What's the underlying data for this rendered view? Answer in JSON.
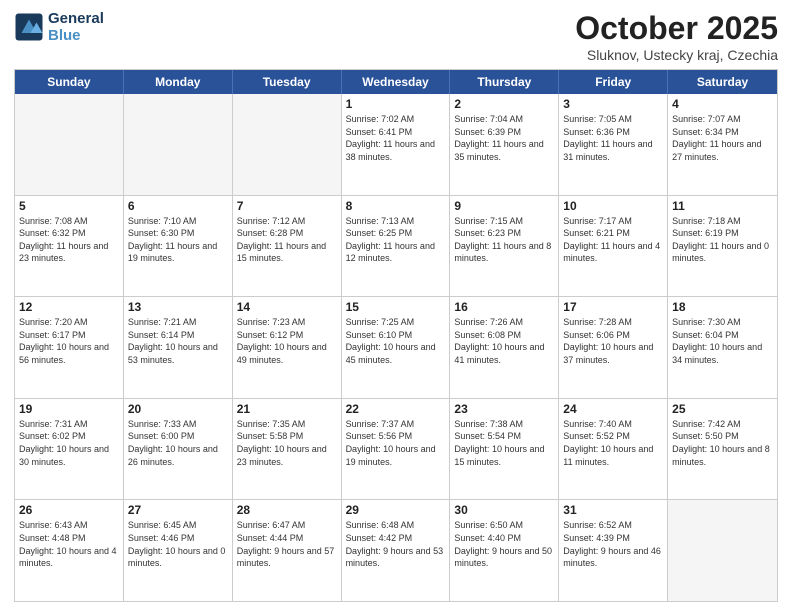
{
  "logo": {
    "line1": "General",
    "line2": "Blue"
  },
  "title": "October 2025",
  "subtitle": "Sluknov, Ustecky kraj, Czechia",
  "header": {
    "days": [
      "Sunday",
      "Monday",
      "Tuesday",
      "Wednesday",
      "Thursday",
      "Friday",
      "Saturday"
    ]
  },
  "rows": [
    [
      {
        "day": "",
        "empty": true
      },
      {
        "day": "",
        "empty": true
      },
      {
        "day": "",
        "empty": true
      },
      {
        "day": "1",
        "rise": "7:02 AM",
        "set": "6:41 PM",
        "daylight": "11 hours and 38 minutes."
      },
      {
        "day": "2",
        "rise": "7:04 AM",
        "set": "6:39 PM",
        "daylight": "11 hours and 35 minutes."
      },
      {
        "day": "3",
        "rise": "7:05 AM",
        "set": "6:36 PM",
        "daylight": "11 hours and 31 minutes."
      },
      {
        "day": "4",
        "rise": "7:07 AM",
        "set": "6:34 PM",
        "daylight": "11 hours and 27 minutes."
      }
    ],
    [
      {
        "day": "5",
        "rise": "7:08 AM",
        "set": "6:32 PM",
        "daylight": "11 hours and 23 minutes."
      },
      {
        "day": "6",
        "rise": "7:10 AM",
        "set": "6:30 PM",
        "daylight": "11 hours and 19 minutes."
      },
      {
        "day": "7",
        "rise": "7:12 AM",
        "set": "6:28 PM",
        "daylight": "11 hours and 15 minutes."
      },
      {
        "day": "8",
        "rise": "7:13 AM",
        "set": "6:25 PM",
        "daylight": "11 hours and 12 minutes."
      },
      {
        "day": "9",
        "rise": "7:15 AM",
        "set": "6:23 PM",
        "daylight": "11 hours and 8 minutes."
      },
      {
        "day": "10",
        "rise": "7:17 AM",
        "set": "6:21 PM",
        "daylight": "11 hours and 4 minutes."
      },
      {
        "day": "11",
        "rise": "7:18 AM",
        "set": "6:19 PM",
        "daylight": "11 hours and 0 minutes."
      }
    ],
    [
      {
        "day": "12",
        "rise": "7:20 AM",
        "set": "6:17 PM",
        "daylight": "10 hours and 56 minutes."
      },
      {
        "day": "13",
        "rise": "7:21 AM",
        "set": "6:14 PM",
        "daylight": "10 hours and 53 minutes."
      },
      {
        "day": "14",
        "rise": "7:23 AM",
        "set": "6:12 PM",
        "daylight": "10 hours and 49 minutes."
      },
      {
        "day": "15",
        "rise": "7:25 AM",
        "set": "6:10 PM",
        "daylight": "10 hours and 45 minutes."
      },
      {
        "day": "16",
        "rise": "7:26 AM",
        "set": "6:08 PM",
        "daylight": "10 hours and 41 minutes."
      },
      {
        "day": "17",
        "rise": "7:28 AM",
        "set": "6:06 PM",
        "daylight": "10 hours and 37 minutes."
      },
      {
        "day": "18",
        "rise": "7:30 AM",
        "set": "6:04 PM",
        "daylight": "10 hours and 34 minutes."
      }
    ],
    [
      {
        "day": "19",
        "rise": "7:31 AM",
        "set": "6:02 PM",
        "daylight": "10 hours and 30 minutes."
      },
      {
        "day": "20",
        "rise": "7:33 AM",
        "set": "6:00 PM",
        "daylight": "10 hours and 26 minutes."
      },
      {
        "day": "21",
        "rise": "7:35 AM",
        "set": "5:58 PM",
        "daylight": "10 hours and 23 minutes."
      },
      {
        "day": "22",
        "rise": "7:37 AM",
        "set": "5:56 PM",
        "daylight": "10 hours and 19 minutes."
      },
      {
        "day": "23",
        "rise": "7:38 AM",
        "set": "5:54 PM",
        "daylight": "10 hours and 15 minutes."
      },
      {
        "day": "24",
        "rise": "7:40 AM",
        "set": "5:52 PM",
        "daylight": "10 hours and 11 minutes."
      },
      {
        "day": "25",
        "rise": "7:42 AM",
        "set": "5:50 PM",
        "daylight": "10 hours and 8 minutes."
      }
    ],
    [
      {
        "day": "26",
        "rise": "6:43 AM",
        "set": "4:48 PM",
        "daylight": "10 hours and 4 minutes."
      },
      {
        "day": "27",
        "rise": "6:45 AM",
        "set": "4:46 PM",
        "daylight": "10 hours and 0 minutes."
      },
      {
        "day": "28",
        "rise": "6:47 AM",
        "set": "4:44 PM",
        "daylight": "9 hours and 57 minutes."
      },
      {
        "day": "29",
        "rise": "6:48 AM",
        "set": "4:42 PM",
        "daylight": "9 hours and 53 minutes."
      },
      {
        "day": "30",
        "rise": "6:50 AM",
        "set": "4:40 PM",
        "daylight": "9 hours and 50 minutes."
      },
      {
        "day": "31",
        "rise": "6:52 AM",
        "set": "4:39 PM",
        "daylight": "9 hours and 46 minutes."
      },
      {
        "day": "",
        "empty": true
      }
    ]
  ]
}
